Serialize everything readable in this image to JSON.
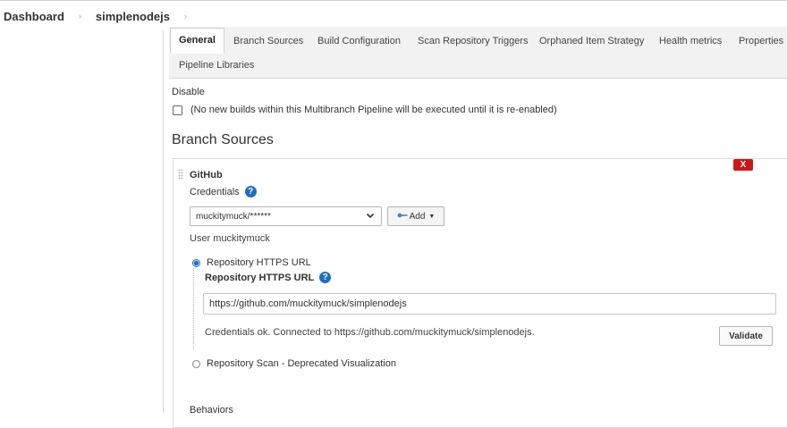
{
  "breadcrumb": {
    "items": [
      "Dashboard",
      "simplenodejs"
    ],
    "separator": "›"
  },
  "tabs": [
    {
      "label": "General",
      "active": true
    },
    {
      "label": "Branch Sources",
      "active": false
    },
    {
      "label": "Build Configuration",
      "active": false
    },
    {
      "label": "Scan Repository Triggers",
      "active": false
    },
    {
      "label": "Orphaned Item Strategy",
      "active": false
    },
    {
      "label": "Health metrics",
      "active": false
    },
    {
      "label": "Properties",
      "active": false
    },
    {
      "label": "Pipeline Libraries",
      "active": false
    }
  ],
  "general": {
    "disable_label": "Disable",
    "disable_checkbox_text": "(No new builds within this Multibranch Pipeline will be executed until it is re-enabled)",
    "disable_checked": false
  },
  "branch_sources": {
    "heading": "Branch Sources",
    "source_title": "GitHub",
    "delete_label": "X",
    "credentials_label": "Credentials",
    "help_glyph": "?",
    "credentials_selected": "muckitymuck/******",
    "add_label": "Add",
    "user_text": "User muckitymuck",
    "radio_https_label": "Repository HTTPS URL",
    "radio_https_checked": true,
    "url_field_label": "Repository HTTPS URL",
    "url_value": "https://github.com/muckitymuck/simplenodejs",
    "credentials_ok_text": "Credentials ok. Connected to https://github.com/muckitymuck/simplenodejs.",
    "validate_label": "Validate",
    "radio_scan_label": "Repository Scan - Deprecated Visualization",
    "radio_scan_checked": false,
    "behaviors_label": "Behaviors"
  },
  "icons": {
    "separator": "chevron-right-icon",
    "help": "help-icon",
    "dropdown": "chevron-down-icon",
    "key": "key-icon",
    "drag": "drag-handle-icon"
  },
  "colors": {
    "help_blue": "#1e6fbf",
    "delete_red": "#cc1818",
    "tab_bar_bg": "#f2f2f2"
  }
}
